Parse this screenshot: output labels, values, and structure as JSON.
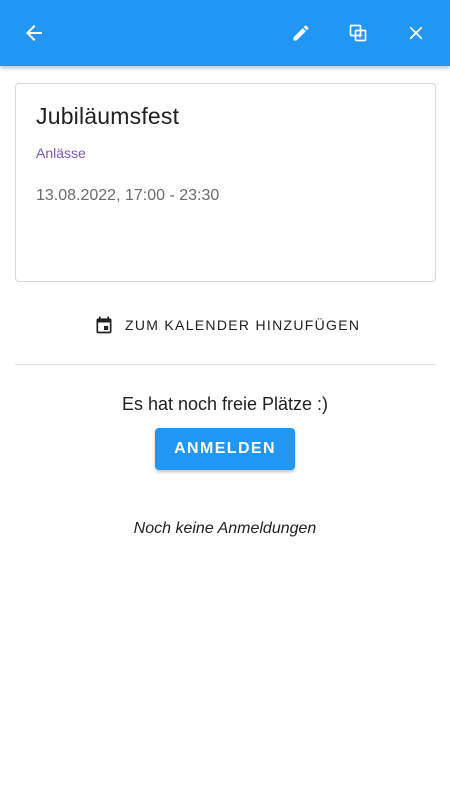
{
  "colors": {
    "primary": "#2196F3",
    "category": "#7e57c2"
  },
  "appbar": {
    "back_icon": "arrow-back-icon",
    "edit_icon": "pencil-icon",
    "copy_icon": "copy-icon",
    "close_icon": "close-icon"
  },
  "event": {
    "title": "Jubiläumsfest",
    "category": "Anlässe",
    "datetime": "13.08.2022, 17:00 - 23:30"
  },
  "calendar_button": {
    "icon": "calendar-icon",
    "label": "ZUM KALENDER HINZUFÜGEN"
  },
  "registration": {
    "status": "Es hat noch freie Plätze :)",
    "button_label": "ANMELDEN",
    "empty_message": "Noch keine Anmeldungen"
  }
}
